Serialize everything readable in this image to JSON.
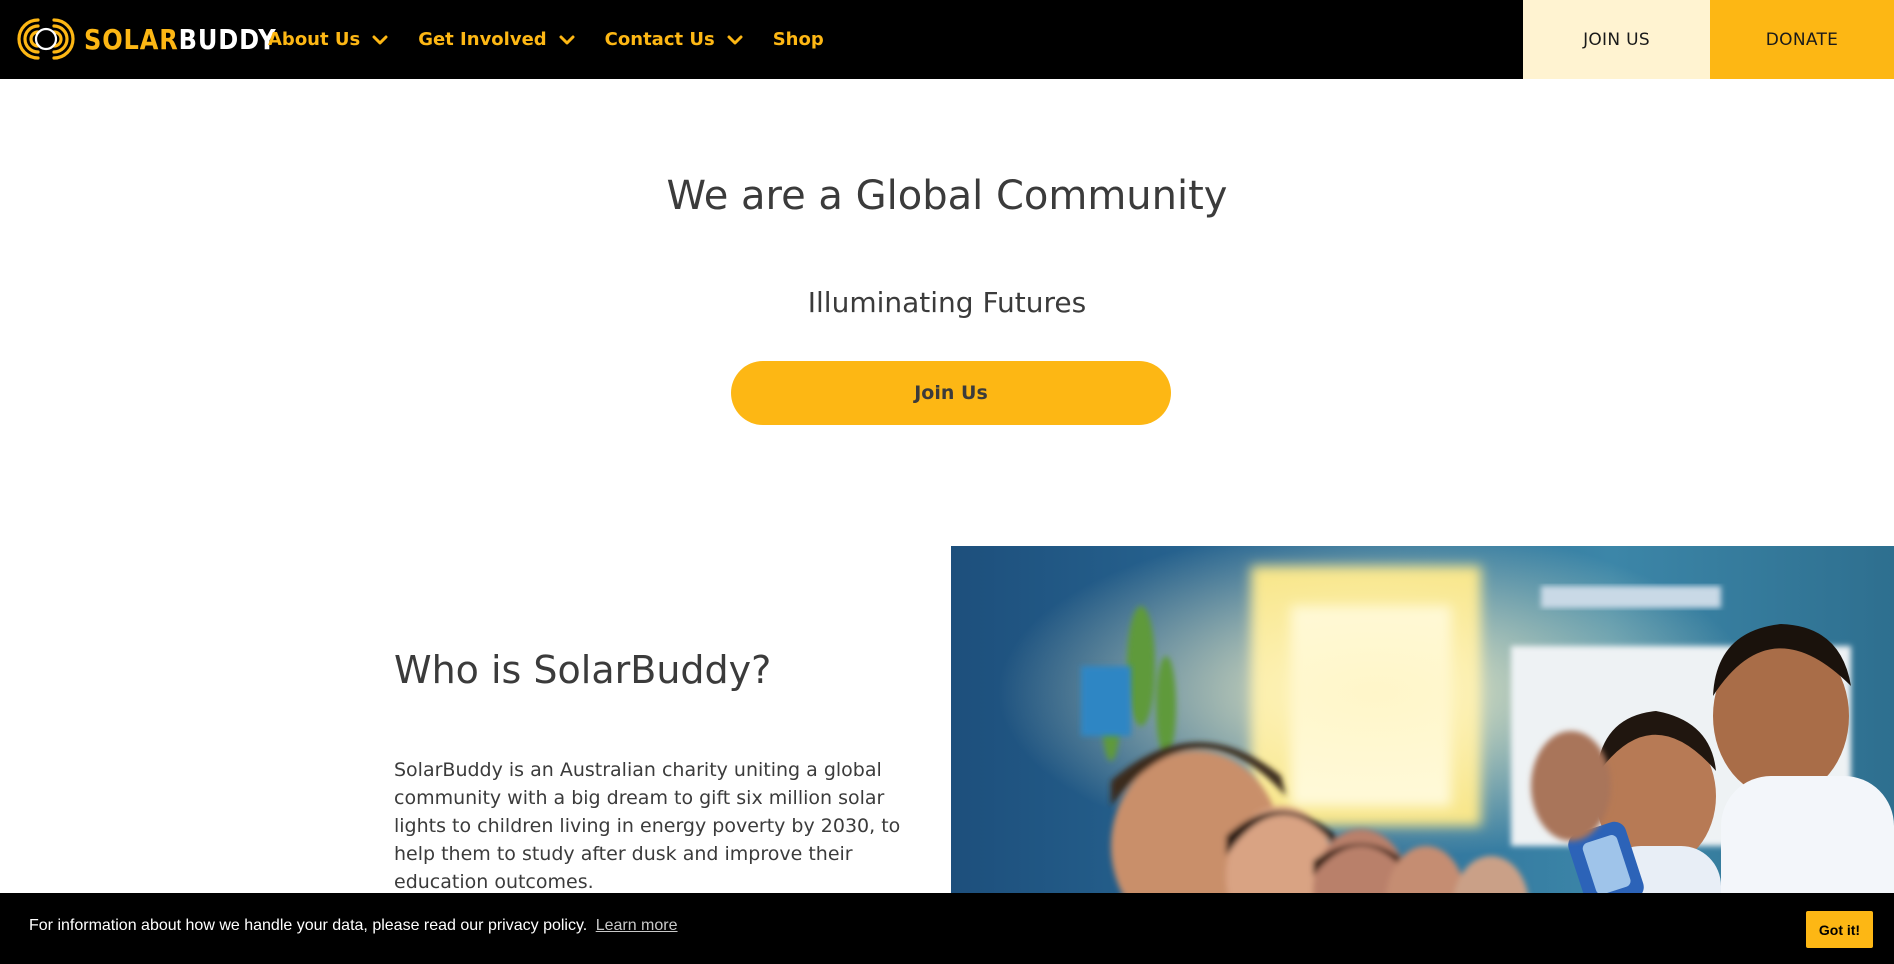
{
  "brand": {
    "name_part1": "SOLAR",
    "name_part2": "BUDDY",
    "accent_color": "#fdb714",
    "icon": "solarbuddy-rings-logo"
  },
  "nav": {
    "items": [
      {
        "label": "About Us",
        "has_dropdown": true
      },
      {
        "label": "Get Involved",
        "has_dropdown": true
      },
      {
        "label": "Contact Us",
        "has_dropdown": true
      },
      {
        "label": "Shop",
        "has_dropdown": false
      }
    ],
    "join_label": "JOIN US",
    "donate_label": "DONATE"
  },
  "hero": {
    "title": "We are a Global Community",
    "subtitle": "Illuminating Futures",
    "button_label": "Join Us"
  },
  "who": {
    "title": "Who is SolarBuddy?",
    "text": "SolarBuddy is an Australian charity uniting a global community with a big dream to gift six million solar lights to children living in energy poverty by 2030, to help them to study after dusk and improve their education outcomes."
  },
  "cookie": {
    "text": "For information about how we handle your data, please read our privacy policy.",
    "link_label": "Learn more",
    "button_label": "Got it!"
  },
  "colors": {
    "topbar_bg": "#000000",
    "join_bg": "#fff3d1",
    "accent": "#fdb714",
    "text": "#3b3b3b"
  }
}
